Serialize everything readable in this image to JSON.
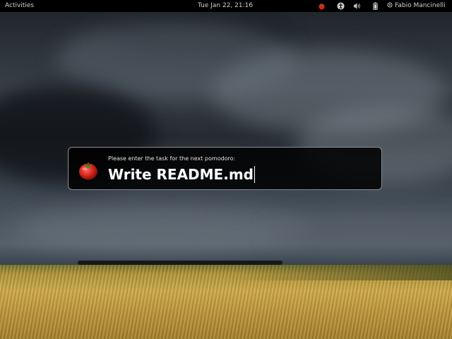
{
  "topbar": {
    "activities_label": "Activities",
    "clock": "Tue Jan 22, 21:16",
    "user_name": "Fabio Mancinelli",
    "icons": [
      "tomato-icon",
      "accessibility-icon",
      "volume-icon",
      "battery-icon",
      "user-status-icon"
    ]
  },
  "dialog": {
    "prompt": "Please enter the task for the next pomodoro:",
    "task_value": "Write README.md",
    "icon": "tomato-icon"
  },
  "colors": {
    "topbar_bg": "#000000",
    "dialog_bg": "#000000",
    "dialog_border": "#8d8d8d",
    "tomato": "#d6241b"
  }
}
